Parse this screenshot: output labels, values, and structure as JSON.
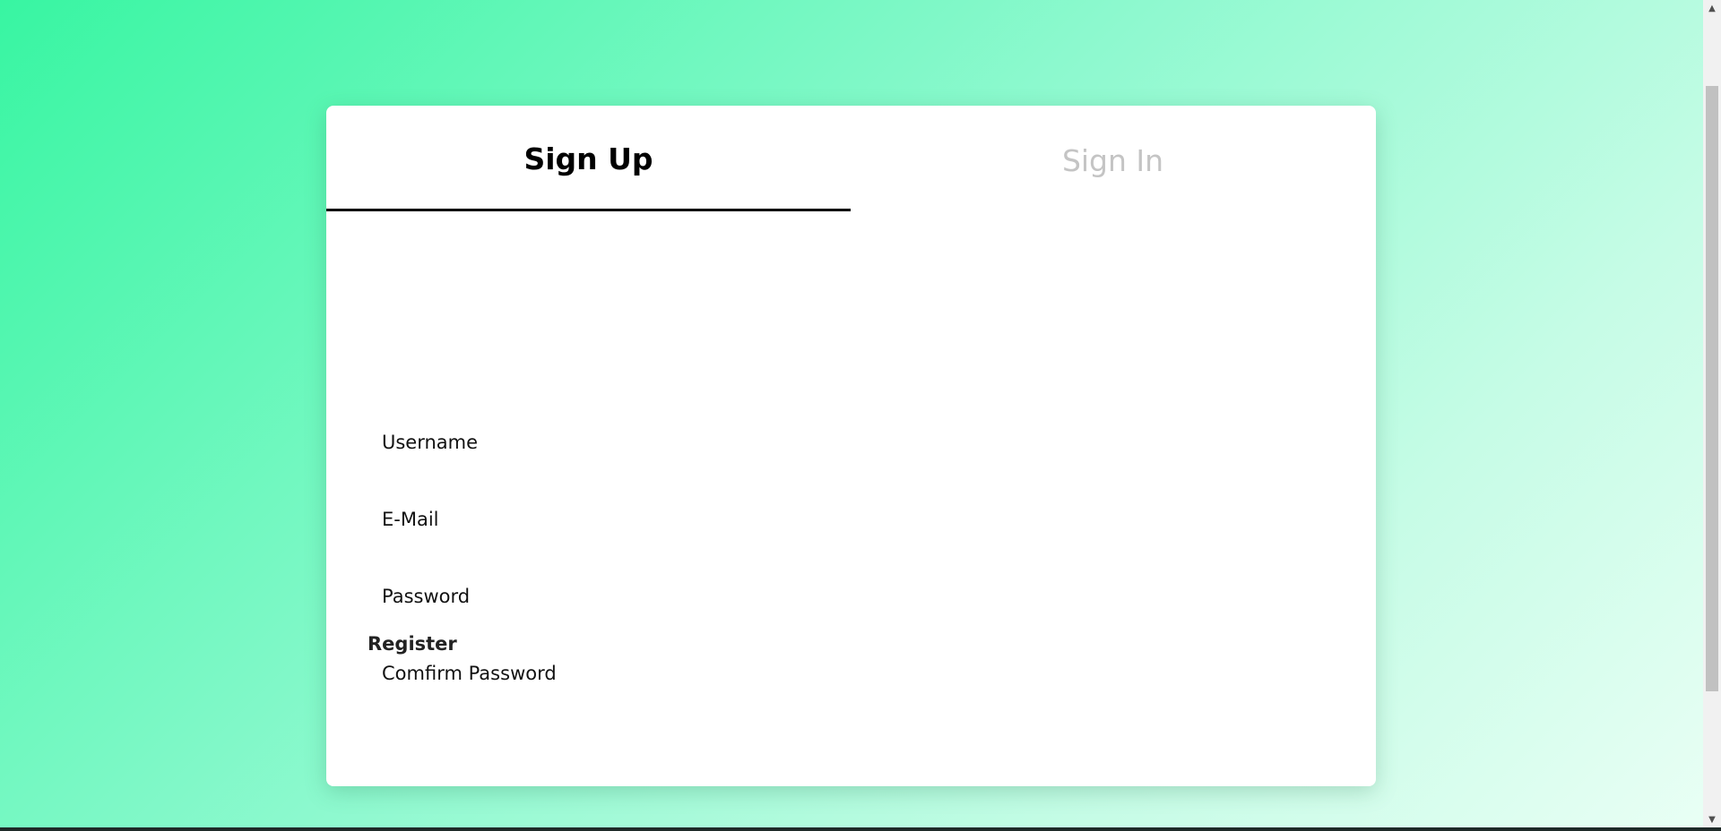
{
  "tabs": {
    "sign_up": "Sign Up",
    "sign_in": "Sign In"
  },
  "form": {
    "username_label": "Username",
    "email_label": "E-Mail",
    "password_label": "Password",
    "confirm_password_label": "Comfirm Password",
    "register_label": "Register"
  },
  "colors": {
    "gradient_start": "#38f5a2",
    "gradient_end": "#eafff5",
    "card_background": "#ffffff",
    "active_tab_text": "#000000",
    "inactive_tab_text": "#c4c4c4"
  },
  "scrollbar": {
    "up_icon": "chevron-up-icon",
    "down_icon": "chevron-down-icon",
    "up_glyph": "▲",
    "down_glyph": "▼"
  }
}
